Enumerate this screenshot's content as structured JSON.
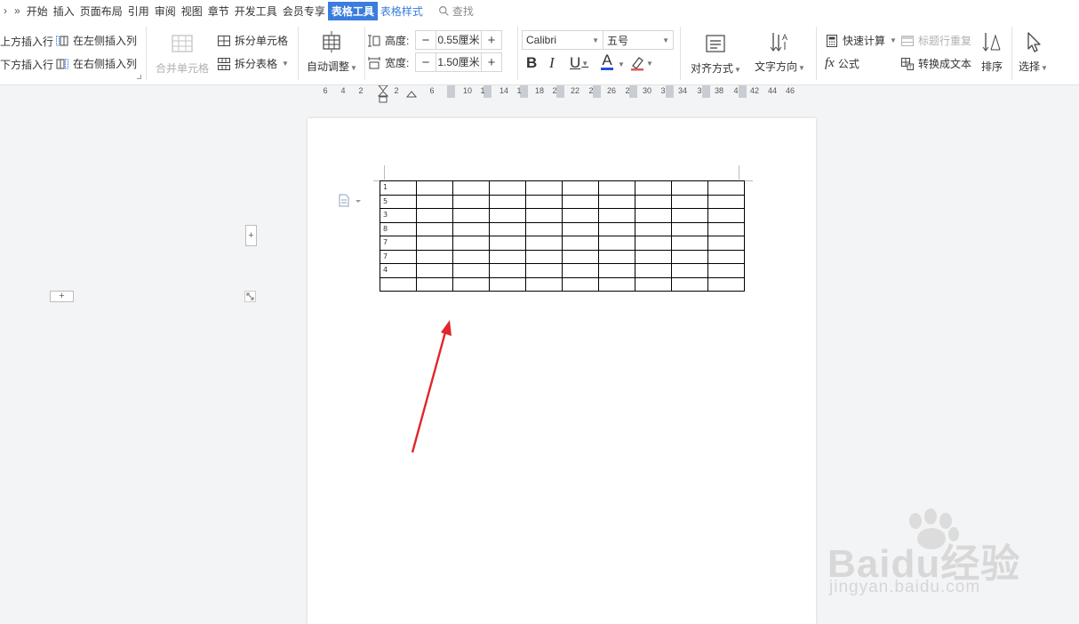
{
  "menubar": {
    "nav_arrow_left": "›",
    "nav_arrow_more": "»",
    "items": [
      "开始",
      "插入",
      "页面布局",
      "引用",
      "审阅",
      "视图",
      "章节",
      "开发工具",
      "会员专享",
      "表格工具",
      "表格样式"
    ],
    "active_item": "表格工具",
    "search_label": "查找"
  },
  "ribbon": {
    "insert_row_above": "上方插入行",
    "insert_row_below": "下方插入行",
    "insert_col_left": "在左侧插入列",
    "insert_col_right": "在右侧插入列",
    "merge_cells": "合并单元格",
    "split_cells": "拆分单元格",
    "split_table": "拆分表格",
    "auto_fit": "自动调整",
    "height_label": "高度:",
    "height_value": "0.55厘米",
    "width_label": "宽度:",
    "width_value": "1.50厘米",
    "font_name": "Calibri",
    "font_size": "五号",
    "bold": "B",
    "italic": "I",
    "underline": "U",
    "font_color": "A",
    "align": "对齐方式",
    "text_direction": "文字方向",
    "quick_calc": "快速计算",
    "repeat_header": "标题行重复",
    "formula": "公式",
    "fx": "fx",
    "convert_to_text": "转换成文本",
    "sort": "排序",
    "select": "选择"
  },
  "ruler": {
    "ticks": [
      "6",
      "4",
      "2",
      "2",
      "6",
      "10",
      "1",
      "14",
      "1",
      "18",
      "2",
      "22",
      "2",
      "26",
      "2",
      "30",
      "3",
      "34",
      "3",
      "38",
      "4",
      "42",
      "44",
      "46"
    ]
  },
  "document": {
    "table_first_column": [
      "1",
      "5",
      "3",
      "8",
      "7",
      "7",
      "4",
      ""
    ],
    "rows": 8,
    "cols": 10
  },
  "watermark": {
    "brand": "Baidu经验",
    "url": "jingyan.baidu.com"
  },
  "colors": {
    "accent": "#3b7ddd",
    "arrow": "#e0262b",
    "font_color_bar": "#2b4fd8",
    "highlight_bar": "#e05a5a"
  }
}
